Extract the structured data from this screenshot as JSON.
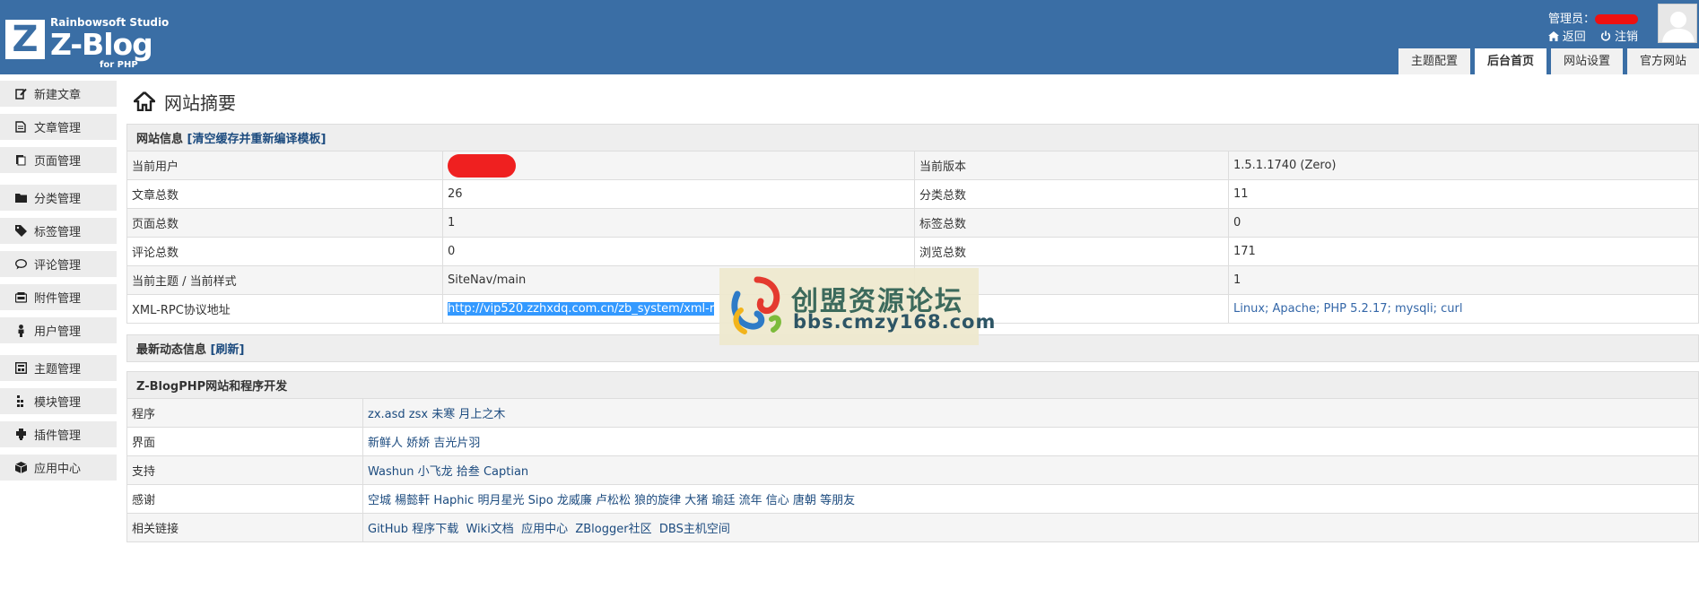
{
  "header": {
    "logo_studio": "Rainbowsoft Studio",
    "logo_brand": "Z-Blog",
    "logo_for": "for PHP",
    "admin_label": "管理员：",
    "back_label": "返回",
    "logout_label": "注销",
    "tabs": [
      "主题配置",
      "后台首页",
      "网站设置",
      "官方网站"
    ],
    "active_tab": "后台首页"
  },
  "sidebar": {
    "items": [
      {
        "label": "新建文章",
        "icon": "edit-icon"
      },
      {
        "label": "文章管理",
        "icon": "article-icon"
      },
      {
        "label": "页面管理",
        "icon": "page-icon"
      },
      {
        "label": "分类管理",
        "icon": "folder-icon"
      },
      {
        "label": "标签管理",
        "icon": "tag-icon"
      },
      {
        "label": "评论管理",
        "icon": "comment-icon"
      },
      {
        "label": "附件管理",
        "icon": "attachment-icon"
      },
      {
        "label": "用户管理",
        "icon": "user-icon"
      },
      {
        "label": "主题管理",
        "icon": "theme-icon"
      },
      {
        "label": "模块管理",
        "icon": "module-icon"
      },
      {
        "label": "插件管理",
        "icon": "plugin-icon"
      },
      {
        "label": "应用中心",
        "icon": "app-center-icon"
      }
    ]
  },
  "main": {
    "title": "网站摘要",
    "site_info": {
      "heading": "网站信息",
      "clear_cache_link": "[清空缓存并重新编译模板]",
      "rows": [
        {
          "label1": "当前用户",
          "value1": "",
          "label2": "当前版本",
          "value2": "1.5.1.1740 (Zero)"
        },
        {
          "label1": "文章总数",
          "value1": "26",
          "label2": "分类总数",
          "value2": "11"
        },
        {
          "label1": "页面总数",
          "value1": "1",
          "label2": "标签总数",
          "value2": "0"
        },
        {
          "label1": "评论总数",
          "value1": "0",
          "label2": "浏览总数",
          "value2": "171"
        },
        {
          "label1": "当前主题 / 当前样式",
          "value1": "SiteNav/main",
          "label2": "",
          "value2": "1"
        },
        {
          "label1": "XML-RPC协议地址",
          "value1": "http://vip520.zzhxdq.com.cn/zb_system/xml-r",
          "label2": "",
          "value2": "Linux; Apache; PHP 5.2.17; mysqli; curl"
        }
      ]
    },
    "news": {
      "heading": "最新动态信息",
      "refresh_link": "[刷新]"
    },
    "dev": {
      "heading": "Z-BlogPHP网站和程序开发",
      "rows": [
        {
          "label": "程序",
          "links": [
            "zx.asd",
            "zsx",
            "未寒",
            "月上之木"
          ]
        },
        {
          "label": "界面",
          "links": [
            "新鲜人",
            "娇娇",
            "吉光片羽"
          ]
        },
        {
          "label": "支持",
          "links": [
            "Washun",
            "小飞龙",
            "拾叁",
            "Captian"
          ]
        },
        {
          "label": "感谢",
          "links": [
            "空城",
            "楊懿軒",
            "Haphic",
            "明月星光",
            "Sipo",
            "龙威廉",
            "卢松松",
            "狼的旋律",
            "大猪",
            "瑜廷",
            "流年",
            "信心",
            "唐朝",
            "等朋友"
          ]
        },
        {
          "label": "相关链接",
          "links": [
            "GitHub",
            "程序下载",
            "Wiki文档",
            "应用中心",
            "ZBlogger社区",
            "DBS主机空间"
          ]
        }
      ]
    }
  },
  "watermark": {
    "cn": "创盟资源论坛",
    "en": "bbs.cmzy168.com"
  },
  "colors": {
    "header_bg": "#3a6ea5",
    "link": "#1c4b7f",
    "redaction": "#ef2020",
    "selection": "#3399ff"
  }
}
